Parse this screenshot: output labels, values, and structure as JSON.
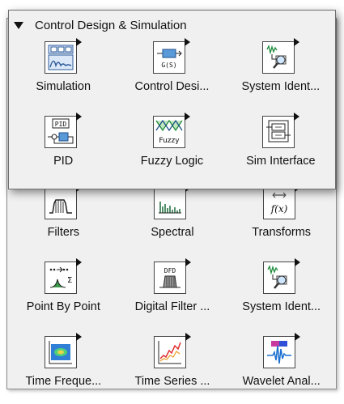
{
  "overlay_palette": {
    "title": "Control Design & Simulation",
    "items": [
      {
        "label": "Simulation",
        "icon": "simulation-icon"
      },
      {
        "label": "Control Desi...",
        "icon": "control-design-icon"
      },
      {
        "label": "System Ident...",
        "icon": "system-identification-icon"
      },
      {
        "label": "PID",
        "icon": "pid-icon"
      },
      {
        "label": "Fuzzy Logic",
        "icon": "fuzzy-logic-icon"
      },
      {
        "label": "Sim Interface",
        "icon": "sim-interface-icon"
      }
    ]
  },
  "background_palette": {
    "items": [
      {
        "label": "Filters",
        "icon": "filters-icon"
      },
      {
        "label": "Spectral",
        "icon": "spectral-icon"
      },
      {
        "label": "Transforms",
        "icon": "transforms-icon"
      },
      {
        "label": "Point By Point",
        "icon": "point-by-point-icon"
      },
      {
        "label": "Digital Filter ...",
        "icon": "digital-filter-icon"
      },
      {
        "label": "System Ident...",
        "icon": "system-identification-icon"
      },
      {
        "label": "Time Freque...",
        "icon": "time-frequency-icon"
      },
      {
        "label": "Time Series ...",
        "icon": "time-series-icon"
      },
      {
        "label": "Wavelet Anal...",
        "icon": "wavelet-analysis-icon"
      }
    ]
  },
  "icon_text": {
    "control_design": "G(S)",
    "pid": "PID",
    "fuzzy": "Fuzzy",
    "transforms": "f(x)",
    "digital_filter": "DFD"
  }
}
